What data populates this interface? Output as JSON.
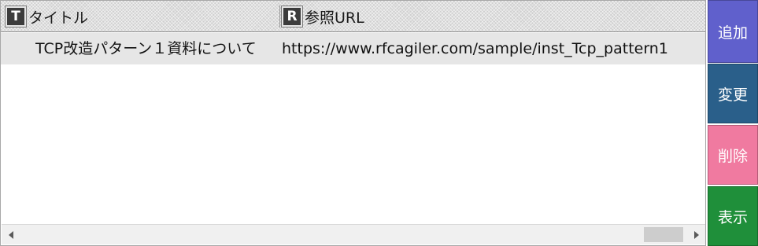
{
  "grid": {
    "columns": [
      {
        "badge": "T",
        "label": "タイトル"
      },
      {
        "badge": "R",
        "label": "参照URL"
      }
    ],
    "rows": [
      {
        "title": "TCP改造パターン１資料について",
        "url": "https://www.rfcagiler.com/sample/inst_Tcp_pattern1"
      }
    ]
  },
  "buttons": {
    "add": "追加",
    "change": "変更",
    "delete": "削除",
    "show": "表示"
  },
  "colors": {
    "add": "#6060cc",
    "change": "#2a5f8a",
    "delete": "#f07aa0",
    "show": "#1f8f3a"
  },
  "icons": {
    "scroll_left": "triangle-left-icon",
    "scroll_right": "triangle-right-icon"
  }
}
